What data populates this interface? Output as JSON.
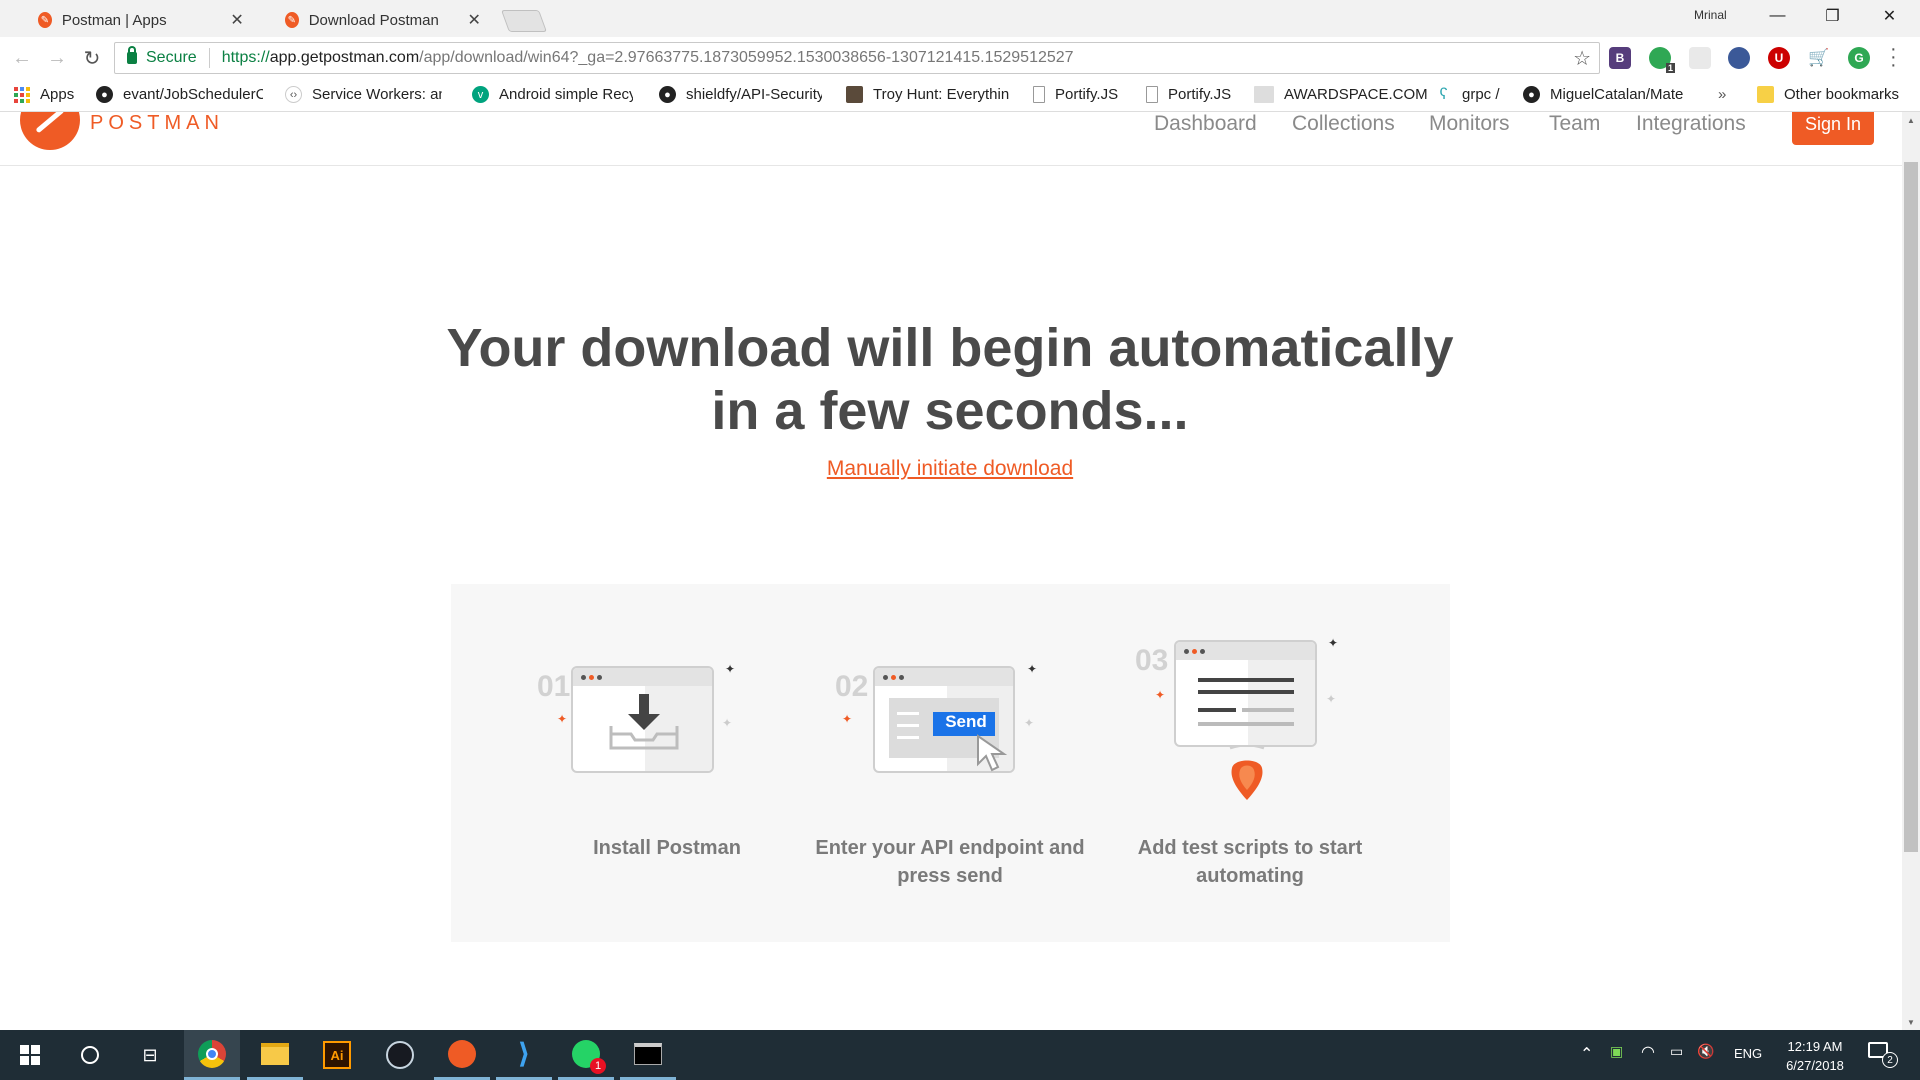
{
  "browser": {
    "tabs": [
      {
        "title": "Postman | Apps",
        "active": false
      },
      {
        "title": "Download Postman",
        "active": true
      }
    ],
    "user_label": "Mrinal",
    "security_label": "Secure",
    "url": {
      "scheme": "https://",
      "host": "app.getpostman.com",
      "path": "/app/download/win64?_ga=2.97663775.1873059952.1530038656-1307121415.1529512527"
    },
    "extensions": [
      "B",
      "1"
    ],
    "bookmarks": [
      {
        "label": "Apps",
        "icon": "apps-grid-icon"
      },
      {
        "label": "evant/JobSchedulerC",
        "icon": "github-icon"
      },
      {
        "label": "Service Workers: an I",
        "icon": "service-workers-icon"
      },
      {
        "label": "Android simple Recy",
        "icon": "vine-icon"
      },
      {
        "label": "shieldfy/API-Security",
        "icon": "github-icon"
      },
      {
        "label": "Troy Hunt: Everything",
        "icon": "avatar-icon"
      },
      {
        "label": "Portify.JS",
        "icon": "page-icon"
      },
      {
        "label": "Portify.JS",
        "icon": "page-icon"
      },
      {
        "label": "AWARDSPACE.COM",
        "icon": "awardspace-icon"
      },
      {
        "label": "grpc /",
        "icon": "grpc-icon"
      },
      {
        "label": "MiguelCatalan/Mate",
        "icon": "github-icon"
      }
    ],
    "bookmarks_overflow": "»",
    "other_bookmarks": "Other bookmarks"
  },
  "site": {
    "logo_text": "POSTMAN",
    "nav": [
      "Dashboard",
      "Collections",
      "Monitors",
      "Team",
      "Integrations"
    ],
    "signin_label": "Sign In",
    "hero_line1": "Your download will begin automatically",
    "hero_line2": "in a few seconds...",
    "manual_link": "Manually initiate download",
    "steps": [
      {
        "number": "01",
        "caption": "Install Postman"
      },
      {
        "number": "02",
        "caption": "Enter your API endpoint and press send",
        "button": "Send"
      },
      {
        "number": "03",
        "caption": "Add test scripts to start automating"
      }
    ]
  },
  "taskbar": {
    "apps": [
      "start",
      "cortana",
      "task-view",
      "chrome",
      "file-explorer",
      "illustrator",
      "steam",
      "postman",
      "vscode",
      "whatsapp",
      "terminal"
    ],
    "whatsapp_badge": "1",
    "language": "ENG",
    "time": "12:19 AM",
    "date": "6/27/2018",
    "notifications": "2"
  },
  "colors": {
    "accent": "#ef5b25",
    "chrome_green": "#0b8043",
    "taskbar": "#1f2d36",
    "send_blue": "#1a73e8"
  }
}
